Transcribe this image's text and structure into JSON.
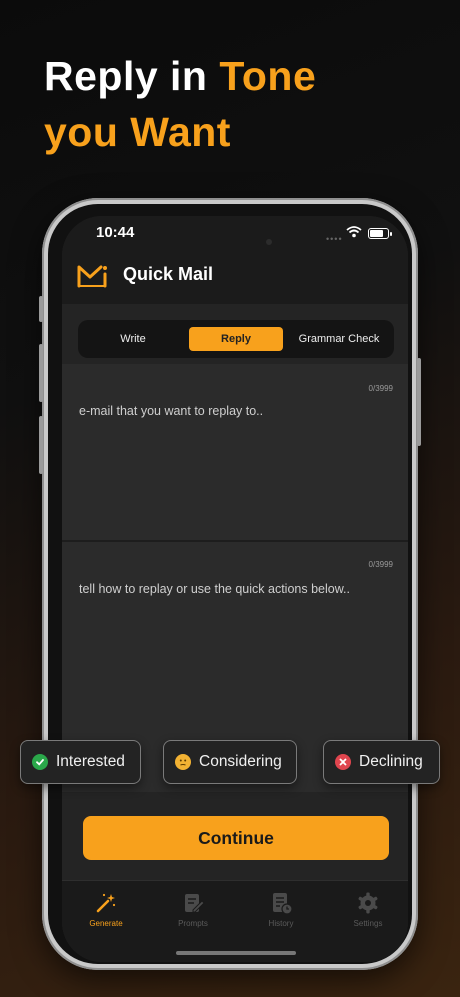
{
  "headline": {
    "part1": "Reply in ",
    "part2": "Tone",
    "part3": "you Want"
  },
  "status_bar": {
    "time": "10:44"
  },
  "app": {
    "title": "Quick Mail"
  },
  "segments": [
    {
      "label": "Write",
      "active": false
    },
    {
      "label": "Reply",
      "active": true
    },
    {
      "label": "Grammar Check",
      "active": false
    }
  ],
  "email_field": {
    "counter": "0/3999",
    "placeholder": "e-mail that you want to replay to.."
  },
  "instruction_field": {
    "counter": "0/3999",
    "placeholder": "tell how to replay or use the quick actions below.."
  },
  "quick_actions": [
    {
      "label": "Interested",
      "icon": "check-circle-icon",
      "color": "#2aa84a"
    },
    {
      "label": "Considering",
      "icon": "thinking-face-icon",
      "color": "#f2b233"
    },
    {
      "label": "Declining",
      "icon": "x-circle-icon",
      "color": "#e0454e"
    }
  ],
  "continue_button": {
    "label": "Continue"
  },
  "tabs": [
    {
      "label": "Generate",
      "icon": "magic-wand-icon",
      "active": true
    },
    {
      "label": "Prompts",
      "icon": "edit-note-icon",
      "active": false
    },
    {
      "label": "History",
      "icon": "history-doc-icon",
      "active": false
    },
    {
      "label": "Settings",
      "icon": "gear-icon",
      "active": false
    }
  ],
  "colors": {
    "accent": "#f8a11c",
    "background": "#242424"
  }
}
